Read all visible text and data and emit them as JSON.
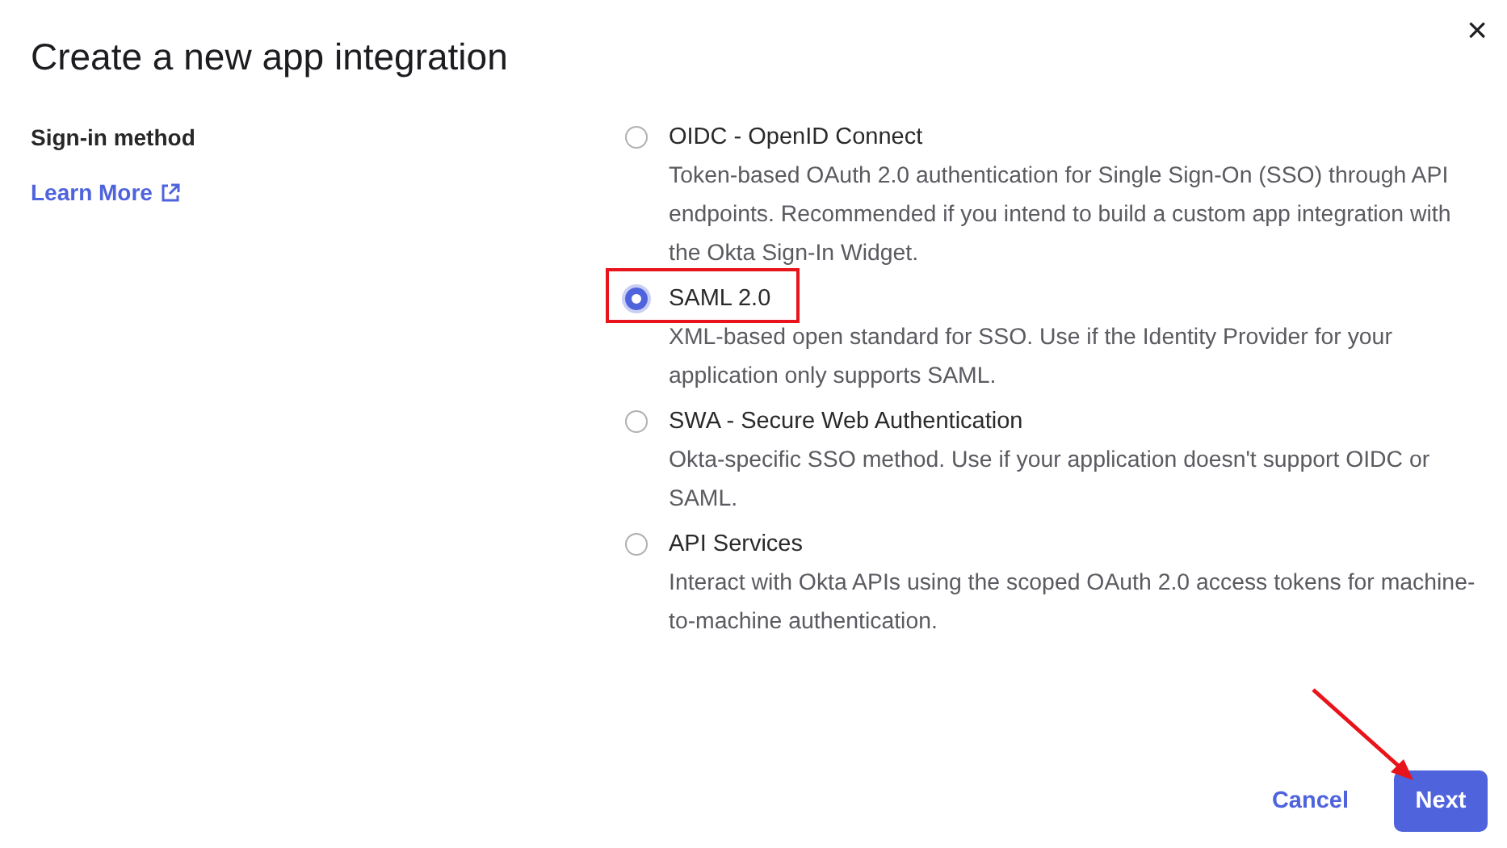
{
  "title": "Create a new app integration",
  "close": "×",
  "field_label": "Sign-in method",
  "learn_more": "Learn More",
  "options": [
    {
      "label": "OIDC - OpenID Connect",
      "description": "Token-based OAuth 2.0 authentication for Single Sign-On (SSO) through API endpoints. Recommended if you intend to build a custom app integration with the Okta Sign-In Widget.",
      "selected": false,
      "highlighted": false
    },
    {
      "label": "SAML 2.0",
      "description": "XML-based open standard for SSO. Use if the Identity Provider for your application only supports SAML.",
      "selected": true,
      "highlighted": true
    },
    {
      "label": "SWA - Secure Web Authentication",
      "description": "Okta-specific SSO method. Use if your application doesn't support OIDC or SAML.",
      "selected": false,
      "highlighted": false
    },
    {
      "label": "API Services",
      "description": "Interact with Okta APIs using the scoped OAuth 2.0 access tokens for machine-to-machine authentication.",
      "selected": false,
      "highlighted": false
    }
  ],
  "buttons": [
    {
      "label": "Cancel",
      "kind": "link",
      "pointed_at": false
    },
    {
      "label": "Next",
      "kind": "primary",
      "pointed_at": true
    }
  ]
}
